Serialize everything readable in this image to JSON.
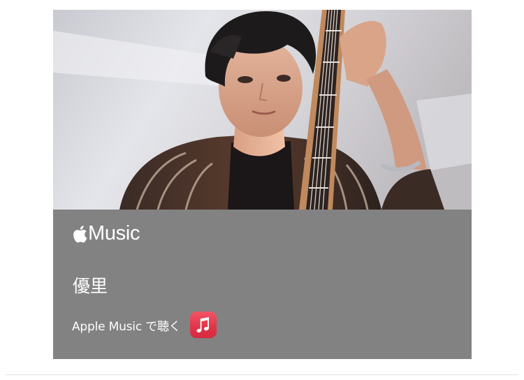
{
  "card": {
    "service_name": "Music",
    "artist_name": "優里",
    "listen_label": "Apple Music で聴く",
    "hero_image": "artist-portrait-with-guitar",
    "panel_color": "#828282",
    "icons": {
      "logo": "apple-logo-icon",
      "app": "apple-music-app-icon",
      "note": "music-note-icon"
    },
    "app_icon_color": "#e2364a"
  }
}
